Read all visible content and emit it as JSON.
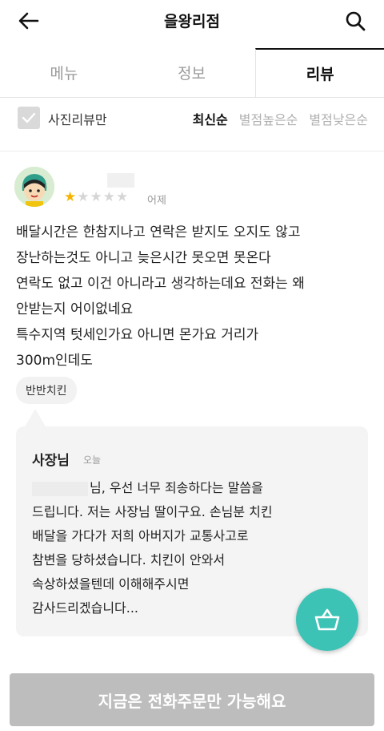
{
  "header": {
    "title": "을왕리점",
    "back_icon": "back-arrow-icon",
    "search_icon": "search-icon"
  },
  "tabs": [
    {
      "label": "메뉴",
      "active": false
    },
    {
      "label": "정보",
      "active": false
    },
    {
      "label": "리뷰",
      "active": true
    }
  ],
  "filter": {
    "photo_only_label": "사진리뷰만",
    "sort_options": [
      {
        "label": "최신순",
        "active": true
      },
      {
        "label": "별점높은순",
        "active": false
      },
      {
        "label": "별점낮은순",
        "active": false
      }
    ]
  },
  "review": {
    "rating": 1,
    "max_rating": 5,
    "date": "어제",
    "lines": [
      "배달시간은 한참지나고 연락은 받지도 오지도 않고",
      "장난하는것도 아니고 늦은시간 못오면 못온다",
      "연락도 없고 이건 아니라고 생각하는데요 전화는 왜",
      "안받는지 어이없네요",
      "특수지역 텃세인가요 아니면 몬가요 거리가",
      "300m인데도"
    ],
    "menu_tag": "반반치킨"
  },
  "reply": {
    "author": "사장님",
    "date": "오늘",
    "first_line_suffix": "님, 우선 너무 죄송하다는 말씀을",
    "lines": [
      "드립니다. 저는 사장님 딸이구요. 손님분 치킨",
      "배달을 가다가 저희 아버지가 교통사고로",
      "참변을 당하셨습니다. 치킨이 안와서",
      "속상하셨을텐데 이해해주시면",
      "감사드리겠습니다..."
    ]
  },
  "cart_icon": "basket-icon",
  "order_button": {
    "label": "지금은 전화주문만 가능해요"
  },
  "colors": {
    "accent": "#3cc3b6",
    "star": "#f5b400",
    "disabled_button": "#bdbdbd"
  }
}
